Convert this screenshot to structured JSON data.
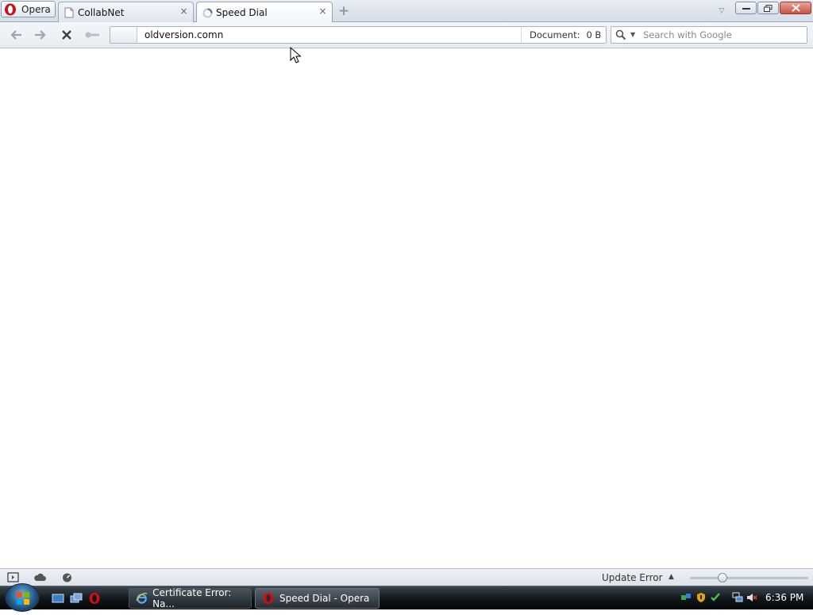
{
  "menu": {
    "label": "Opera"
  },
  "tabs": [
    {
      "label": "CollabNet",
      "close": "×"
    },
    {
      "label": "Speed Dial",
      "close": "×"
    }
  ],
  "address": {
    "url": "oldversion.comn",
    "document_label": "Document:",
    "document_size": "0 B"
  },
  "search": {
    "placeholder": "Search with Google"
  },
  "statusbar": {
    "update_text": "Update Error"
  },
  "taskbar": {
    "tasks": [
      {
        "label": "Certificate Error: Na..."
      },
      {
        "label": "Speed Dial - Opera"
      }
    ],
    "clock": "6:36 PM"
  },
  "colors": {
    "opera_red": "#cc0f16",
    "accent_blue": "#1d4f7a"
  }
}
